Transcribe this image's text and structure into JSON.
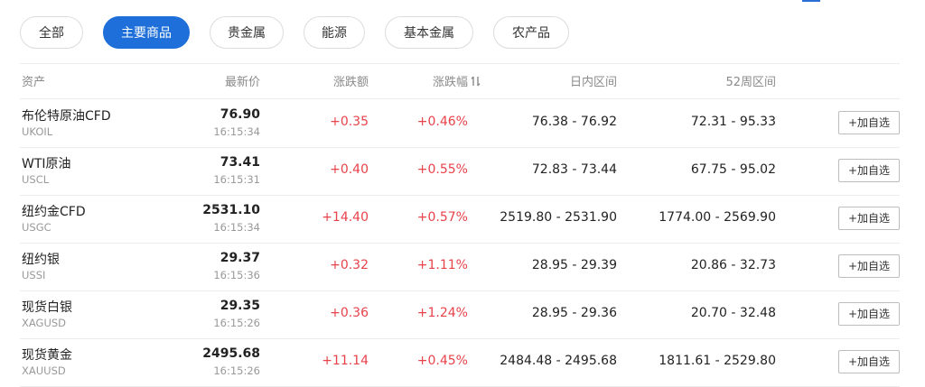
{
  "tabs": [
    {
      "label": "全部",
      "active": false
    },
    {
      "label": "主要商品",
      "active": true
    },
    {
      "label": "贵金属",
      "active": false
    },
    {
      "label": "能源",
      "active": false
    },
    {
      "label": "基本金属",
      "active": false
    },
    {
      "label": "农产品",
      "active": false
    }
  ],
  "columns": {
    "asset": "资产",
    "last": "最新价",
    "change": "涨跌额",
    "change_pct": "涨跌幅",
    "day_range": "日内区间",
    "week52_range": "52周区间"
  },
  "sort_icon": "sort-updown-icon",
  "add_label": "+加自选",
  "up_color": "#e8424a",
  "accent_color": "#1e6fd9",
  "rows": [
    {
      "name": "布伦特原油CFD",
      "code": "UKOIL",
      "price": "76.90",
      "time": "16:15:34",
      "change": "+0.35",
      "change_pct": "+0.46%",
      "day_range": "76.38 - 76.92",
      "week52_range": "72.31 - 95.33"
    },
    {
      "name": "WTI原油",
      "code": "USCL",
      "price": "73.41",
      "time": "16:15:31",
      "change": "+0.40",
      "change_pct": "+0.55%",
      "day_range": "72.83 - 73.44",
      "week52_range": "67.75 - 95.02"
    },
    {
      "name": "纽约金CFD",
      "code": "USGC",
      "price": "2531.10",
      "time": "16:15:34",
      "change": "+14.40",
      "change_pct": "+0.57%",
      "day_range": "2519.80 - 2531.90",
      "week52_range": "1774.00 - 2569.90"
    },
    {
      "name": "纽约银",
      "code": "USSI",
      "price": "29.37",
      "time": "16:15:36",
      "change": "+0.32",
      "change_pct": "+1.11%",
      "day_range": "28.95 - 29.39",
      "week52_range": "20.86 - 32.73"
    },
    {
      "name": "现货白银",
      "code": "XAGUSD",
      "price": "29.35",
      "time": "16:15:26",
      "change": "+0.36",
      "change_pct": "+1.24%",
      "day_range": "28.95 - 29.36",
      "week52_range": "20.70 - 32.48"
    },
    {
      "name": "现货黄金",
      "code": "XAUUSD",
      "price": "2495.68",
      "time": "16:15:26",
      "change": "+11.14",
      "change_pct": "+0.45%",
      "day_range": "2484.48 - 2495.68",
      "week52_range": "1811.61 - 2529.80"
    }
  ]
}
